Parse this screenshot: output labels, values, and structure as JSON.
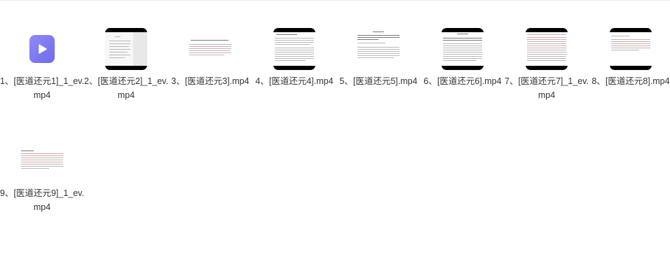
{
  "files": [
    {
      "name": "1、[医道还元1]_1_ev.mp4",
      "thumb": "app-icon"
    },
    {
      "name": "2、[医道还元2]_1_ev.mp4",
      "thumb": "video-doc"
    },
    {
      "name": "3、[医道还元3].mp4",
      "thumb": "flat-doc"
    },
    {
      "name": "4、[医道还元4].mp4",
      "thumb": "video-doc"
    },
    {
      "name": "5、[医道还元5].mp4",
      "thumb": "flat-doc"
    },
    {
      "name": "6、[医道还元6].mp4",
      "thumb": "video-doc"
    },
    {
      "name": "7、[医道还元7]_1_ev.mp4",
      "thumb": "video-doc"
    },
    {
      "name": "8、[医道还元8].mp4",
      "thumb": "video-doc"
    },
    {
      "name": "9、[医道还元9]_1_ev.mp4",
      "thumb": "flat-doc"
    }
  ],
  "colors": {
    "icon_gradient_start": "#8e8cf6",
    "icon_gradient_end": "#6e6bea"
  }
}
